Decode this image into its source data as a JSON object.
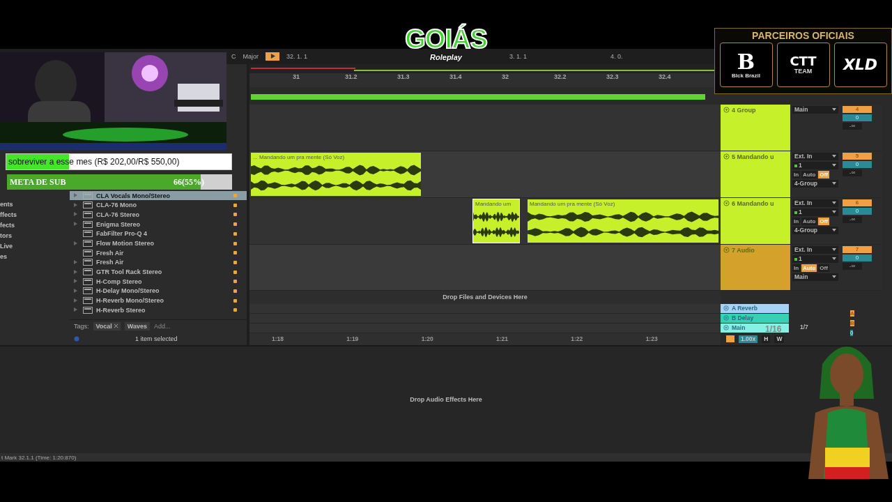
{
  "logo": {
    "title": "GOIÁS",
    "subtitle": "Roleplay"
  },
  "partners": {
    "title": "PARCEIROS OFICIAIS",
    "brands": [
      {
        "kind": "gothic",
        "mark": "B",
        "caption": "Blck Brazil"
      },
      {
        "kind": "shield",
        "mark": "CTT",
        "caption": "TEAM"
      },
      {
        "kind": "script",
        "mark": "XLD"
      }
    ]
  },
  "donation_goal": {
    "text": "sobreviver a esse mes (R$ 202,00/R$ 550,00)",
    "level": 0.28
  },
  "sub_goal": {
    "label": "META DE SUB",
    "count": "66(55%)",
    "level": 0.86
  },
  "transport": {
    "key": "C",
    "scale": "Major",
    "position": "32. 1. 1",
    "loop_start": "3. 1. 1",
    "loop_length": "4. 0."
  },
  "browser": {
    "categories": [
      "ents",
      "ffects",
      "fects",
      "tors",
      "Live",
      "es"
    ],
    "items": [
      {
        "name": "CLA Vocals Mono/Stereo",
        "expandable": true,
        "selected": true
      },
      {
        "name": "CLA-76 Mono",
        "expandable": true,
        "selected": false
      },
      {
        "name": "CLA-76 Stereo",
        "expandable": true,
        "selected": false
      },
      {
        "name": "Enigma Stereo",
        "expandable": true,
        "selected": false
      },
      {
        "name": "FabFilter Pro-Q 4",
        "expandable": false,
        "selected": false
      },
      {
        "name": "Flow Motion Stereo",
        "expandable": true,
        "selected": false
      },
      {
        "name": "Fresh Air",
        "expandable": false,
        "selected": false
      },
      {
        "name": "Fresh Air",
        "expandable": true,
        "selected": false
      },
      {
        "name": "GTR Tool Rack Stereo",
        "expandable": true,
        "selected": false
      },
      {
        "name": "H-Comp Stereo",
        "expandable": true,
        "selected": false
      },
      {
        "name": "H-Delay Mono/Stereo",
        "expandable": true,
        "selected": false
      },
      {
        "name": "H-Reverb Mono/Stereo",
        "expandable": true,
        "selected": false
      },
      {
        "name": "H-Reverb Stereo",
        "expandable": true,
        "selected": false
      }
    ],
    "tags_label": "Tags:",
    "tags": [
      {
        "label": "Vocal",
        "removable": true
      },
      {
        "label": "Waves",
        "removable": false
      }
    ],
    "tag_placeholder": "Add...",
    "status": "1 item selected"
  },
  "arrangement": {
    "ruler": [
      "31",
      "31.2",
      "31.3",
      "31.4",
      "32",
      "32.2",
      "32.3",
      "32.4"
    ],
    "time_ruler": [
      "1:18",
      "1:19",
      "1:20",
      "1:21",
      "1:22",
      "1:23"
    ],
    "grid": "1/16",
    "drop_hint": "Drop Files and Devices Here"
  },
  "tracks": [
    {
      "kind": "group",
      "name": "4 Group",
      "color": "#c6f12a",
      "output": "Main",
      "number": "4",
      "volume": "0",
      "peak": "-∞"
    },
    {
      "kind": "audio",
      "name": "5 Mandando u",
      "color": "#c6f12a",
      "input": "Ext. In",
      "channel": "1",
      "monitor": [
        {
          "label": "In",
          "selected": false
        },
        {
          "label": "Auto",
          "selected": false
        },
        {
          "label": "Off",
          "selected": true
        }
      ],
      "output": "4-Group",
      "number": "5",
      "volume": "0",
      "peak": "-∞",
      "clips": [
        {
          "title": "... Mandando um pra mente (Só Voz)",
          "selected": false
        }
      ]
    },
    {
      "kind": "audio",
      "name": "6 Mandando u",
      "color": "#c6f12a",
      "input": "Ext. In",
      "channel": "1",
      "monitor": [
        {
          "label": "In",
          "selected": false
        },
        {
          "label": "Auto",
          "selected": false
        },
        {
          "label": "Off",
          "selected": true
        }
      ],
      "output": "4-Group",
      "number": "6",
      "volume": "0",
      "peak": "-∞",
      "clips": [
        {
          "title": "Mandando um",
          "selected": true
        },
        {
          "title": "Mandando um pra mente (Só Voz)",
          "selected": false
        }
      ]
    },
    {
      "kind": "audio",
      "name": "7 Audio",
      "color": "#d4a22a",
      "input": "Ext. In",
      "channel": "1",
      "monitor": [
        {
          "label": "In",
          "selected": false
        },
        {
          "label": "Auto",
          "selected": true
        },
        {
          "label": "Off",
          "selected": false
        }
      ],
      "output": "Main",
      "number": "7",
      "volume": "0",
      "peak": "-∞"
    }
  ],
  "returns": [
    {
      "kind": "return",
      "name": "A Reverb",
      "color": "#a6d2f7",
      "send": "A"
    },
    {
      "kind": "return",
      "name": "B Delay",
      "color": "#33d1b5",
      "send": "B"
    },
    {
      "kind": "main",
      "name": "Main",
      "color": "#86f0e4",
      "label": "1/7",
      "volume": "0"
    }
  ],
  "mixer_footer": {
    "zoom": "1.00x",
    "buttons": [
      "H",
      "W"
    ]
  },
  "device_view": {
    "drop_hint": "Drop Audio Effects Here"
  },
  "status_bar": {
    "text": "t Mark 32.1.1 (Time: 1:20:870)"
  }
}
